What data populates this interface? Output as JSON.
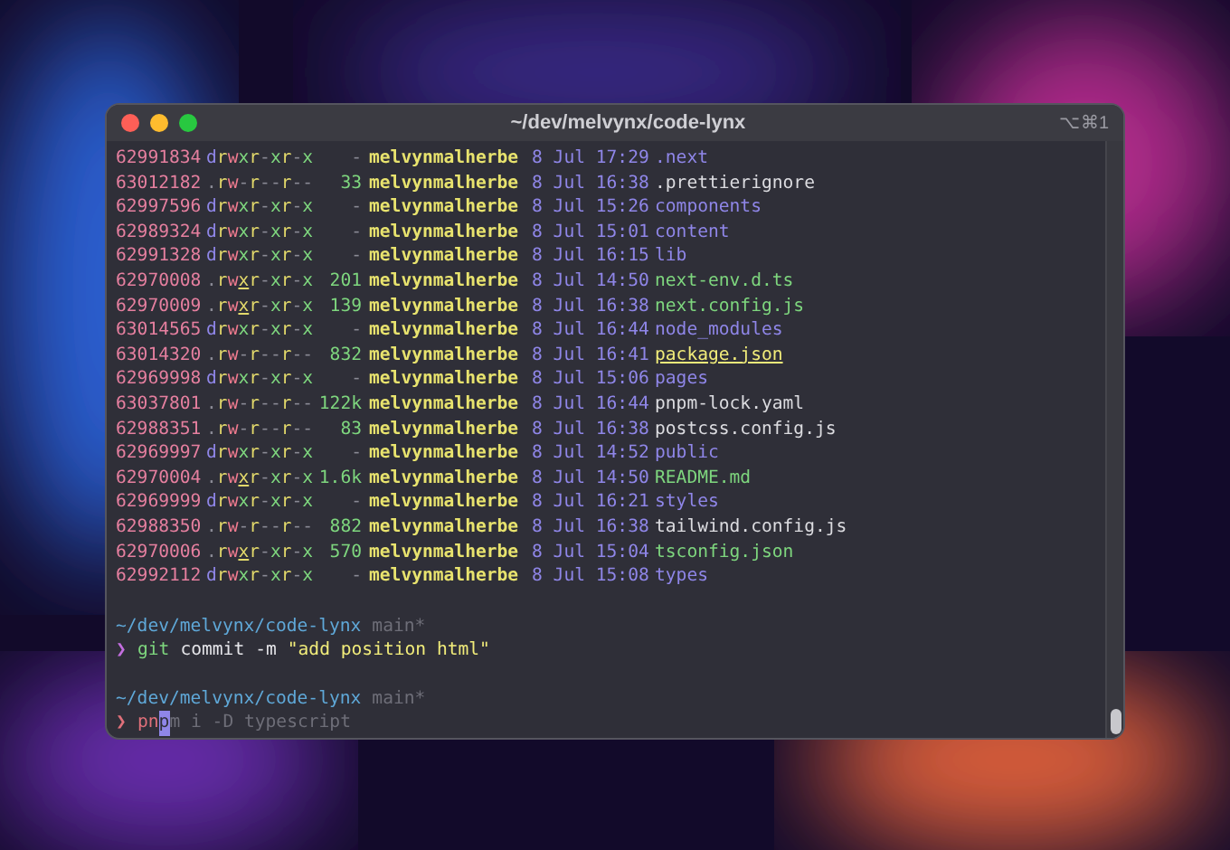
{
  "window": {
    "title": "~/dev/melvynx/code-lynx",
    "shortcut": "⌥⌘1"
  },
  "listing": [
    {
      "inode": "62991834",
      "perms": "drwxr-xr-x",
      "size": "-",
      "user": "melvynmalherbe",
      "date": "8 Jul 17:29",
      "name": ".next",
      "kind": "dir"
    },
    {
      "inode": "63012182",
      "perms": ".rw-r--r--",
      "size": "33",
      "user": "melvynmalherbe",
      "date": "8 Jul 16:38",
      "name": ".prettierignore",
      "kind": "plain"
    },
    {
      "inode": "62997596",
      "perms": "drwxr-xr-x",
      "size": "-",
      "user": "melvynmalherbe",
      "date": "8 Jul 15:26",
      "name": "components",
      "kind": "dir"
    },
    {
      "inode": "62989324",
      "perms": "drwxr-xr-x",
      "size": "-",
      "user": "melvynmalherbe",
      "date": "8 Jul 15:01",
      "name": "content",
      "kind": "dir"
    },
    {
      "inode": "62991328",
      "perms": "drwxr-xr-x",
      "size": "-",
      "user": "melvynmalherbe",
      "date": "8 Jul 16:15",
      "name": "lib",
      "kind": "dir"
    },
    {
      "inode": "62970008",
      "perms": ".rwxr-xr-x",
      "size": "201",
      "user": "melvynmalherbe",
      "date": "8 Jul 14:50",
      "name": "next-env.d.ts",
      "kind": "executable"
    },
    {
      "inode": "62970009",
      "perms": ".rwxr-xr-x",
      "size": "139",
      "user": "melvynmalherbe",
      "date": "8 Jul 16:38",
      "name": "next.config.js",
      "kind": "executable"
    },
    {
      "inode": "63014565",
      "perms": "drwxr-xr-x",
      "size": "-",
      "user": "melvynmalherbe",
      "date": "8 Jul 16:44",
      "name": "node_modules",
      "kind": "dir"
    },
    {
      "inode": "63014320",
      "perms": ".rw-r--r--",
      "size": "832",
      "user": "melvynmalherbe",
      "date": "8 Jul 16:41",
      "name": "package.json",
      "kind": "highlight"
    },
    {
      "inode": "62969998",
      "perms": "drwxr-xr-x",
      "size": "-",
      "user": "melvynmalherbe",
      "date": "8 Jul 15:06",
      "name": "pages",
      "kind": "dir"
    },
    {
      "inode": "63037801",
      "perms": ".rw-r--r--",
      "size": "122k",
      "user": "melvynmalherbe",
      "date": "8 Jul 16:44",
      "name": "pnpm-lock.yaml",
      "kind": "plain"
    },
    {
      "inode": "62988351",
      "perms": ".rw-r--r--",
      "size": "83",
      "user": "melvynmalherbe",
      "date": "8 Jul 16:38",
      "name": "postcss.config.js",
      "kind": "plain"
    },
    {
      "inode": "62969997",
      "perms": "drwxr-xr-x",
      "size": "-",
      "user": "melvynmalherbe",
      "date": "8 Jul 14:52",
      "name": "public",
      "kind": "dir"
    },
    {
      "inode": "62970004",
      "perms": ".rwxr-xr-x",
      "size": "1.6k",
      "user": "melvynmalherbe",
      "date": "8 Jul 14:50",
      "name": "README.md",
      "kind": "executable"
    },
    {
      "inode": "62969999",
      "perms": "drwxr-xr-x",
      "size": "-",
      "user": "melvynmalherbe",
      "date": "8 Jul 16:21",
      "name": "styles",
      "kind": "dir"
    },
    {
      "inode": "62988350",
      "perms": ".rw-r--r--",
      "size": "882",
      "user": "melvynmalherbe",
      "date": "8 Jul 16:38",
      "name": "tailwind.config.js",
      "kind": "plain"
    },
    {
      "inode": "62970006",
      "perms": ".rwxr-xr-x",
      "size": "570",
      "user": "melvynmalherbe",
      "date": "8 Jul 15:04",
      "name": "tsconfig.json",
      "kind": "executable"
    },
    {
      "inode": "62992112",
      "perms": "drwxr-xr-x",
      "size": "-",
      "user": "melvynmalherbe",
      "date": "8 Jul 15:08",
      "name": "types",
      "kind": "dir"
    }
  ],
  "prompts": [
    {
      "path": "~/dev/melvynx/code-lynx",
      "branch": "main*",
      "symbol": "❯",
      "active": false,
      "tokens": [
        {
          "text": "git",
          "kind": "command"
        },
        {
          "text": "commit",
          "kind": "arg"
        },
        {
          "text": "-m",
          "kind": "arg"
        },
        {
          "text": "\"add position html\"",
          "kind": "string"
        }
      ]
    },
    {
      "path": "~/dev/melvynx/code-lynx",
      "branch": "main*",
      "symbol": "❯",
      "active": true,
      "typed": "pn",
      "cursor": "p",
      "suggestion": "m i -D typescript"
    }
  ]
}
